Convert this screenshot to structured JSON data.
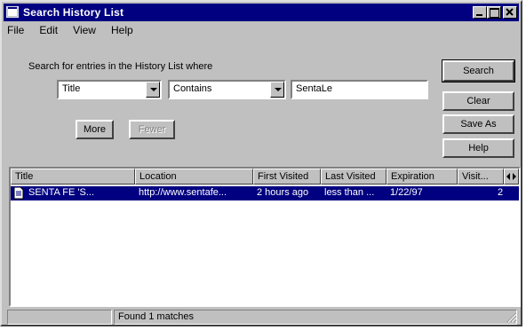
{
  "window": {
    "title": "Search History List"
  },
  "menu": [
    "File",
    "Edit",
    "View",
    "Help"
  ],
  "search": {
    "label": "Search for entries in the History List where",
    "field": "Title",
    "condition": "Contains",
    "value": "SentaLe"
  },
  "buttons": {
    "more": "More",
    "fewer": "Fewer",
    "search": "Search",
    "clear": "Clear",
    "save_as": "Save As",
    "help": "Help"
  },
  "table": {
    "columns": [
      "Title",
      "Location",
      "First Visited",
      "Last Visited",
      "Expiration",
      "Visit..."
    ],
    "rows": [
      [
        "SENTA FE 'S...",
        "http://www.sentafe...",
        "2 hours ago",
        "less than ...",
        "1/22/97",
        "2"
      ]
    ]
  },
  "status": {
    "text": "Found 1 matches"
  }
}
